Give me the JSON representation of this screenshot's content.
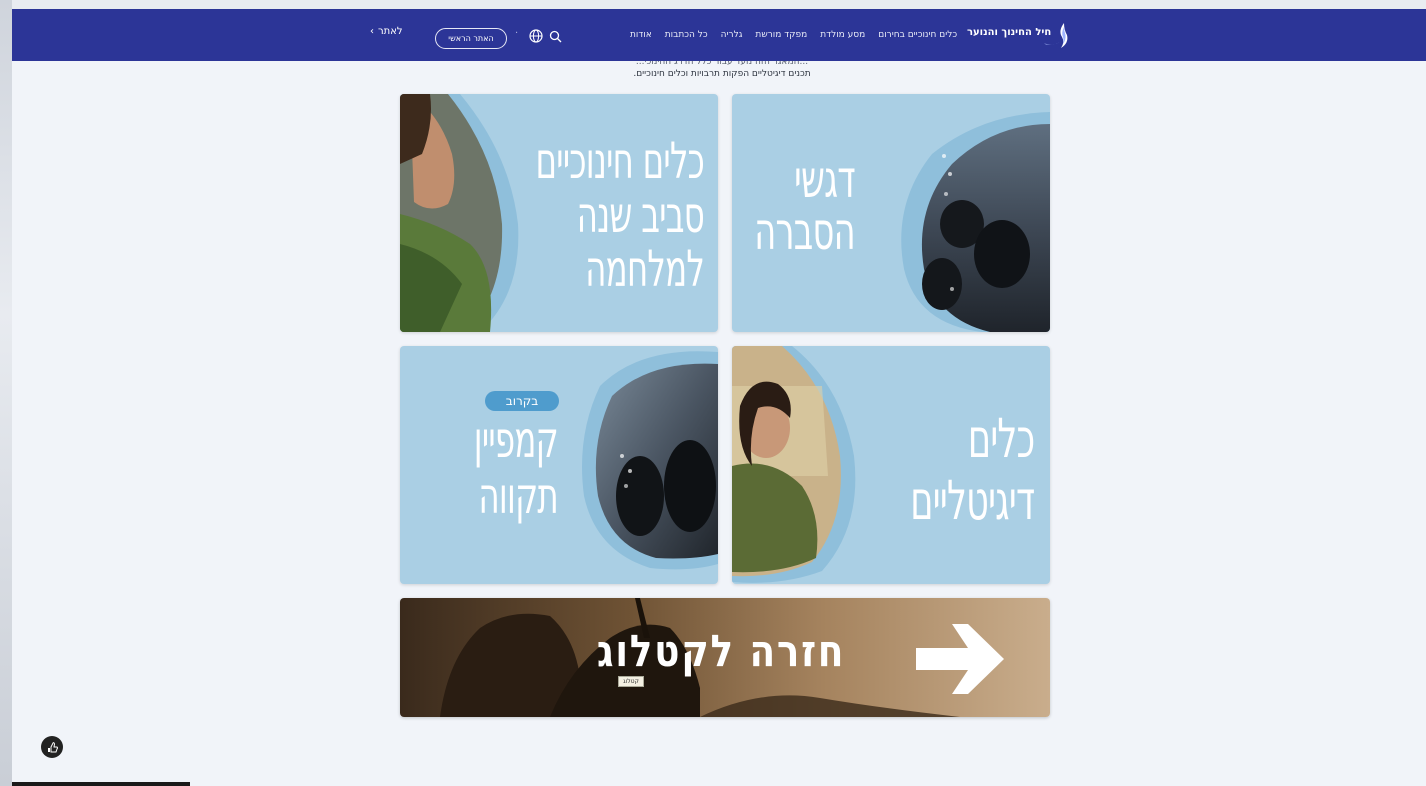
{
  "colors": {
    "navbar": "#2c3597",
    "card_background": "#aacfe4",
    "badge": "#4f9ccd",
    "page_background": "#f1f4f9"
  },
  "header": {
    "brand": "חיל החינוך והנוער",
    "menu": [
      "אודות",
      "כל הכתבות",
      "גלריה",
      "מפקד מורשת",
      "מסע מולדת",
      "כלים חינוכיים בחירום"
    ],
    "main_site_label": "האתר הראשי",
    "lang_label": "לאתר",
    "icons": [
      "logo-flame-icon",
      "globe-icon",
      "search-icon",
      "chevron-left-icon"
    ]
  },
  "intro": {
    "line_cut": "...המאגר הזה נועד עבור כלל הדרג החינוכי...",
    "line": "תכנים דיגיטליים הפקות תרבויות וכלים חינוכיים."
  },
  "cards": {
    "explanation": {
      "line1": "דגשי",
      "line2": "הסברה"
    },
    "education_tools": {
      "line1": "כלים חינוכיים",
      "line2": "סביב שנה",
      "line3": "למלחמה"
    },
    "digital_tools": {
      "line1": "כלים",
      "line2": "דיגיטליים"
    },
    "campaign": {
      "badge": "בקרוב",
      "line1": "קמפיין",
      "line2": "תקווה"
    }
  },
  "catalog": {
    "title": "חזרה לקטלוג",
    "tag": "קטלוג",
    "arrow_icon": "arrow-right-icon"
  }
}
